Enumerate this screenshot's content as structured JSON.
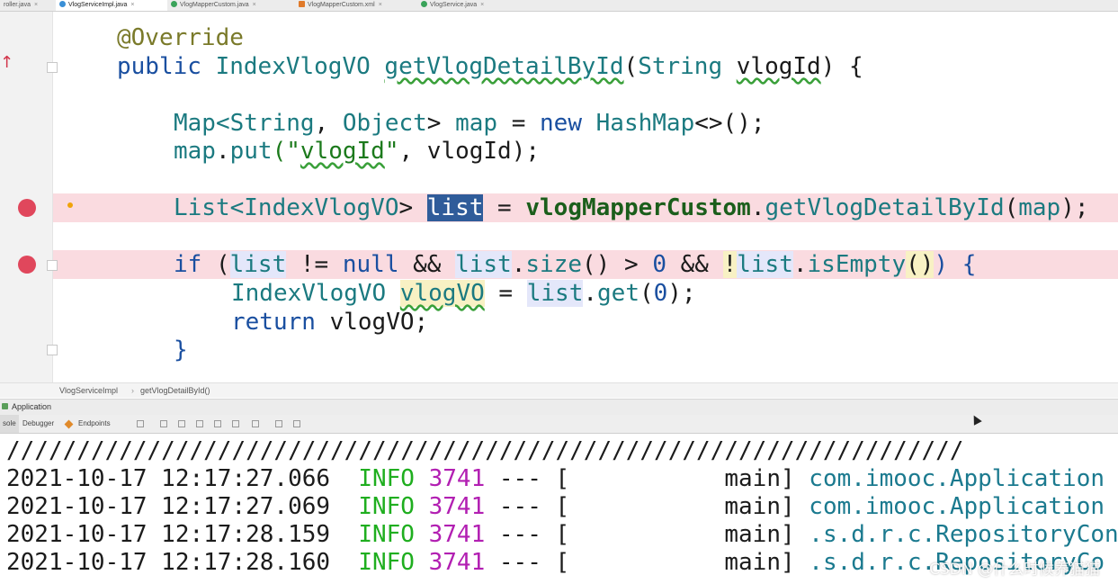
{
  "tabs": [
    {
      "label": "roller.java",
      "icon": "class-icon"
    },
    {
      "label": "VlogServiceImpl.java",
      "icon": "class-icon",
      "active": true
    },
    {
      "label": "VlogMapperCustom.java",
      "icon": "interface-icon"
    },
    {
      "label": "VlogMapperCustom.xml",
      "icon": "xml-icon"
    },
    {
      "label": "VlogService.java",
      "icon": "interface-icon"
    }
  ],
  "code": {
    "l1": "@Override",
    "l2_kw": "public",
    "l2_type": "IndexVlogVO",
    "l2_method": "getVlogDetailById",
    "l2_paren": "(",
    "l2_ptype": "String",
    "l2_param": "vlogId",
    "l2_end": ") {",
    "l3_a": "Map<",
    "l3_b": "String",
    "l3_c": ", ",
    "l3_d": "Object",
    "l3_e": "> ",
    "l3_f": "map",
    "l3_g": " = ",
    "l3_h": "new",
    "l3_i": " ",
    "l3_j": "HashMap",
    "l3_k": "<>();",
    "l4_a": "map",
    "l4_b": ".",
    "l4_c": "put",
    "l4_d": "(\"",
    "l4_e": "vlogId",
    "l4_f": "\"",
    "l4_g": ", vlogId);",
    "l5_a": "List<",
    "l5_b": "IndexVlogVO",
    "l5_c": "> ",
    "l5_d": "list",
    "l5_e": " = ",
    "l5_f": "vlogMapperCustom",
    "l5_g": ".",
    "l5_h": "getVlogDetailById",
    "l5_i": "(",
    "l5_j": "map",
    "l5_k": ");",
    "l6_a": "if",
    "l6_b": " (",
    "l6_c": "list",
    "l6_d": " != ",
    "l6_e": "null",
    "l6_f": " && ",
    "l6_g": "list",
    "l6_h": ".",
    "l6_i": "size",
    "l6_j": "() > ",
    "l6_k": "0",
    "l6_l": " && ",
    "l6_m": "!",
    "l6_n": "list",
    "l6_o": ".",
    "l6_p": "isEmpty",
    "l6_q": "()",
    "l6_r": ") {",
    "l7_a": "IndexVlogVO",
    "l7_b": " ",
    "l7_c": "vlogVO",
    "l7_d": " = ",
    "l7_e": "list",
    "l7_f": ".",
    "l7_g": "get",
    "l7_h": "(",
    "l7_i": "0",
    "l7_j": ");",
    "l8_a": "return",
    "l8_b": " vlogVO;",
    "l9": "}"
  },
  "breadcrumb": [
    "VlogServiceImpl",
    "getVlogDetailById()"
  ],
  "run_window": {
    "title": "Application",
    "tabs": [
      "sole",
      "Debugger",
      "Endpoints"
    ]
  },
  "console": {
    "separator": "////////////////////////////////////////////////////////////////////",
    "lines": [
      {
        "ts": "2021-10-17 12:17:27.066",
        "level": "INFO",
        "pid": "3741",
        "sep": " --- [",
        "thread": "main]",
        "logger": "com.imooc.Application"
      },
      {
        "ts": "2021-10-17 12:17:27.069",
        "level": "INFO",
        "pid": "3741",
        "sep": " --- [",
        "thread": "main]",
        "logger": "com.imooc.Application"
      },
      {
        "ts": "2021-10-17 12:17:28.159",
        "level": "INFO",
        "pid": "3741",
        "sep": " --- [",
        "thread": "main]",
        "logger": ".s.d.r.c.RepositoryCon"
      },
      {
        "ts": "2021-10-17 12:17:28.160",
        "level": "INFO",
        "pid": "3741",
        "sep": " --- [",
        "thread": "main]",
        "logger": ".s.d.r.c.RepositoryCo"
      }
    ]
  },
  "watermark": "CSDN @什么时候养猫猫",
  "colors": {
    "breakpoint": "#e0475c",
    "breakpoint_line": "#fadbe0",
    "info": "#1fae1f",
    "pid": "#b21fb2",
    "logger": "#1b7a8f"
  }
}
